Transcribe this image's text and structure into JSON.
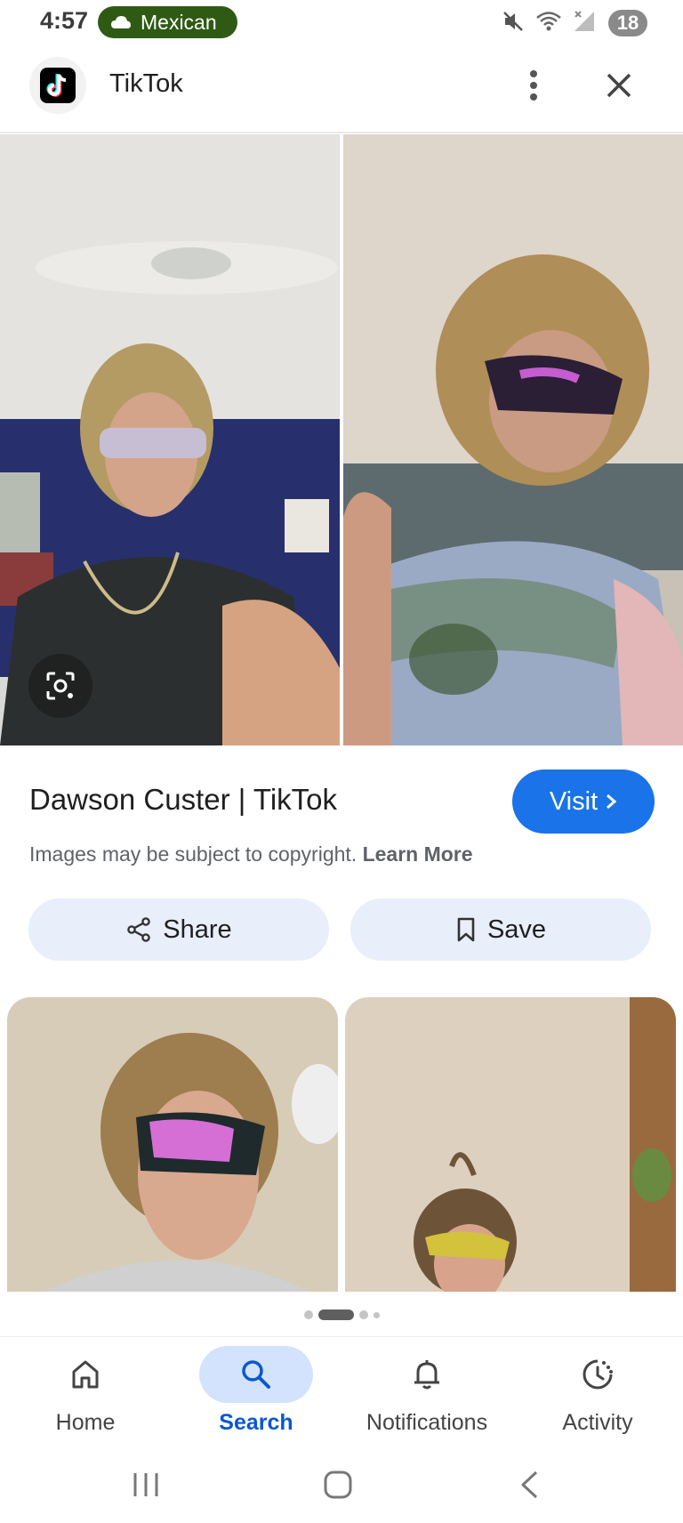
{
  "status_bar": {
    "time": "4:57",
    "pill_text": "Mexican",
    "pill_icon": "cloud-icon",
    "battery": "18",
    "icons": [
      "mute-icon",
      "wifi-icon",
      "signal-icon"
    ]
  },
  "header": {
    "app_name": "TikTok",
    "app_logo": "tiktok-logo",
    "more_icon": "more-vert-icon",
    "close_icon": "close-icon"
  },
  "result": {
    "title": "Dawson Custer | TikTok",
    "visit_label": "Visit",
    "copyright_text": "Images may be subject to copyright.",
    "learn_more": "Learn More",
    "share_label": "Share",
    "save_label": "Save"
  },
  "pager": {
    "count": 4,
    "active_index": 1
  },
  "bottom_nav": {
    "items": [
      {
        "label": "Home",
        "icon": "home-icon"
      },
      {
        "label": "Search",
        "icon": "search-icon"
      },
      {
        "label": "Notifications",
        "icon": "bell-icon"
      },
      {
        "label": "Activity",
        "icon": "activity-icon"
      }
    ],
    "active": "Search"
  },
  "colors": {
    "accent": "#1a73e8",
    "action_pill": "#e8effb",
    "nav_active_pill": "#d3e3fd",
    "status_pill": "#2f5a14"
  }
}
